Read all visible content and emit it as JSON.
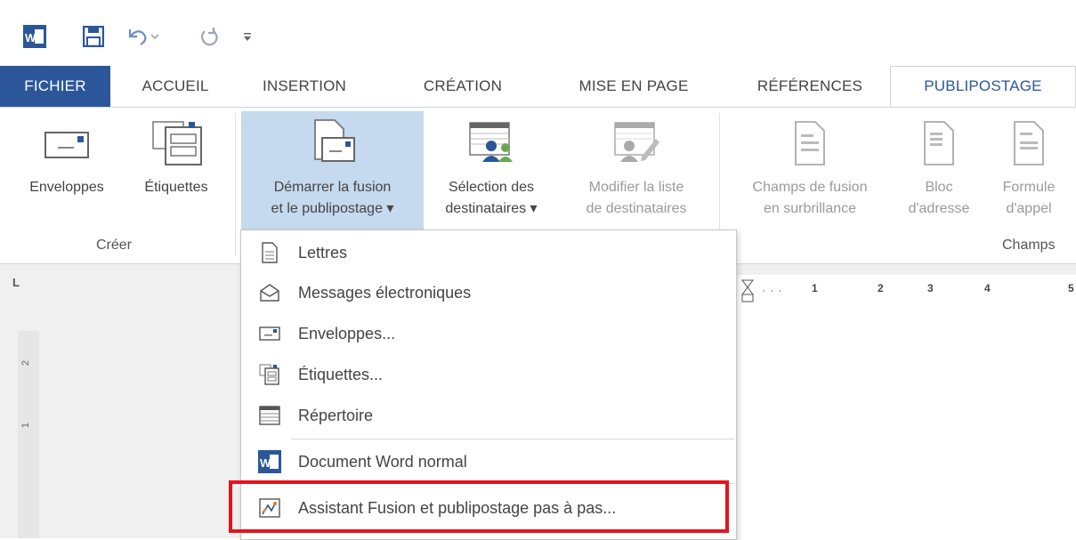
{
  "quick_access": {
    "icons": [
      "word-app-icon",
      "save-icon",
      "undo-icon",
      "redo-icon",
      "customize-qat-icon"
    ]
  },
  "tabs": [
    {
      "label": "FICHIER"
    },
    {
      "label": "ACCUEIL"
    },
    {
      "label": "INSERTION"
    },
    {
      "label": "CRÉATION"
    },
    {
      "label": "MISE EN PAGE"
    },
    {
      "label": "RÉFÉRENCES"
    },
    {
      "label": "PUBLIPOSTAGE"
    }
  ],
  "ribbon": {
    "creer": {
      "group_label": "Créer",
      "enveloppes": "Enveloppes",
      "etiquettes": "Étiquettes"
    },
    "demarrer": {
      "line1": "Démarrer la fusion",
      "line2": "et le publipostage ▾"
    },
    "selection": {
      "line1": "Sélection des",
      "line2": "destinataires ▾"
    },
    "modifier": {
      "line1": "Modifier la liste",
      "line2": "de destinataires"
    },
    "champs": {
      "group_label": "Champs",
      "champs_fusion_1": "Champs de fusion",
      "champs_fusion_2": "en surbrillance",
      "bloc_1": "Bloc",
      "bloc_2": "d'adresse",
      "formule_1": "Formule",
      "formule_2": "d'appel"
    }
  },
  "ruler": {
    "corner": "L",
    "ticks": [
      "1",
      "2",
      "3",
      "4",
      "5"
    ],
    "vticks": [
      "2",
      "1"
    ]
  },
  "menu": {
    "items": [
      {
        "label": "Lettres",
        "icon": "letter-icon"
      },
      {
        "label": "Messages électroniques",
        "icon": "email-envelope-icon"
      },
      {
        "label": "Enveloppes...",
        "icon": "envelope-icon"
      },
      {
        "label": "Étiquettes...",
        "icon": "labels-icon"
      },
      {
        "label": "Répertoire",
        "icon": "directory-icon"
      },
      {
        "label": "Document Word normal",
        "icon": "word-document-icon"
      },
      {
        "label": "Assistant Fusion et publipostage pas à pas...",
        "icon": "wizard-icon"
      }
    ]
  },
  "colors": {
    "file_tab": "#2b579a",
    "pressed_button": "#c5d9ef",
    "highlight_box": "#e5131c"
  }
}
